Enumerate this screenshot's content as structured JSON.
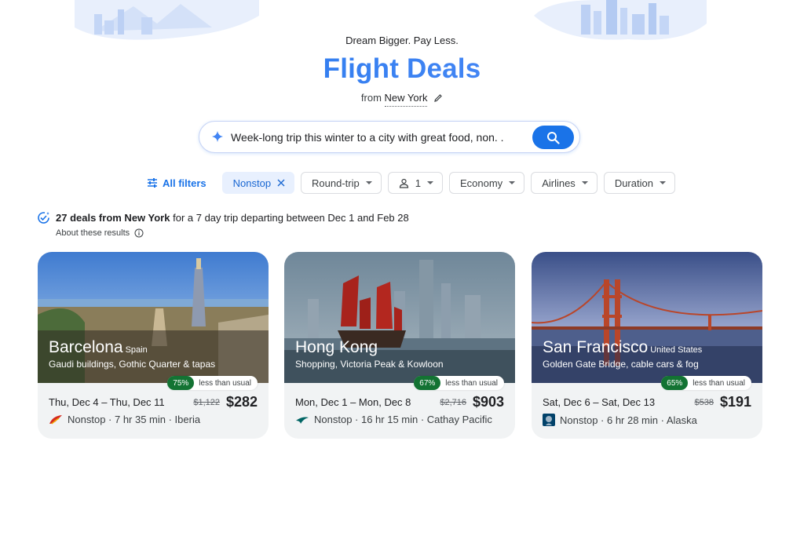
{
  "header": {
    "tagline": "Dream Bigger. Pay Less.",
    "title": "Flight Deals",
    "from_prefix": "from",
    "from_city": "New York"
  },
  "search": {
    "query": "Week-long trip this winter to a city with great food, non. ."
  },
  "filters": {
    "all_filters": "All filters",
    "chips": [
      {
        "label": "Nonstop"
      },
      {
        "label": "Round-trip"
      },
      {
        "label": "1"
      },
      {
        "label": "Economy"
      },
      {
        "label": "Airlines"
      },
      {
        "label": "Duration"
      }
    ]
  },
  "summary": {
    "count_text": "27 deals from New York",
    "rest_text": " for a 7 day trip departing between Dec 1 and Feb 28",
    "about": "About these results"
  },
  "deals": [
    {
      "city": "Barcelona",
      "country": "Spain",
      "description": "Gaudi buildings, Gothic Quarter & tapas",
      "savings_pct": "75%",
      "savings_text": "less than usual",
      "dates": "Thu, Dec 4 – Thu, Dec 11",
      "old_price": "$1,122",
      "price": "$282",
      "flight": "Nonstop · 7 hr 35 min · Iberia"
    },
    {
      "city": "Hong Kong",
      "country": "",
      "description": "Shopping, Victoria Peak & Kowloon",
      "savings_pct": "67%",
      "savings_text": "less than usual",
      "dates": "Mon, Dec 1 – Mon, Dec 8",
      "old_price": "$2,716",
      "price": "$903",
      "flight": "Nonstop · 16 hr 15 min · Cathay Pacific"
    },
    {
      "city": "San Francisco",
      "country": "United States",
      "description": "Golden Gate Bridge, cable cars & fog",
      "savings_pct": "65%",
      "savings_text": "less than usual",
      "dates": "Sat, Dec 6 – Sat, Dec 13",
      "old_price": "$538",
      "price": "$191",
      "flight": "Nonstop · 6 hr 28 min · Alaska"
    }
  ],
  "colors": {
    "accent": "#1a73e8",
    "savings_badge": "#137333",
    "chip_active_bg": "#e8f0fe"
  }
}
